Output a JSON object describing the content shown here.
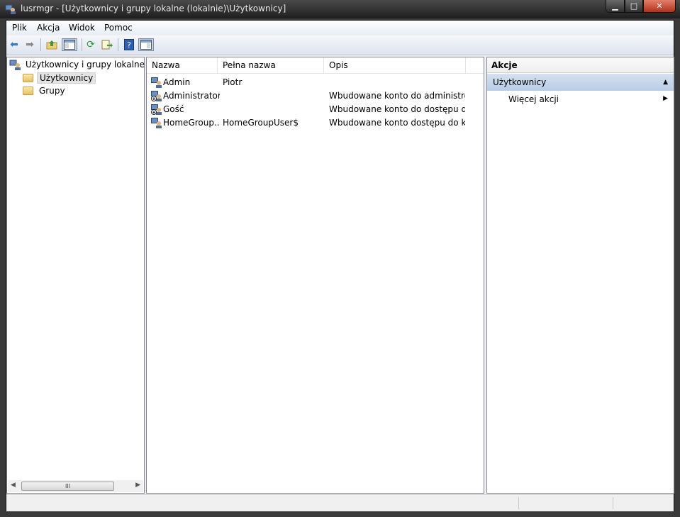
{
  "window": {
    "title": "lusrmgr - [Użytkownicy i grupy lokalne (lokalnie)\\Użytkownicy]"
  },
  "menu": [
    "Plik",
    "Akcja",
    "Widok",
    "Pomoc"
  ],
  "toolbar": {
    "icons": [
      "back-arrow-icon",
      "forward-arrow-icon",
      "up-folder-icon",
      "show-hide-tree-icon",
      "refresh-icon",
      "export-list-icon",
      "help-icon",
      "show-hide-action-pane-icon"
    ]
  },
  "tree": {
    "root": "Użytkownicy i grupy lokalne (lok",
    "items": [
      "Użytkownicy",
      "Grupy"
    ]
  },
  "list": {
    "columns": [
      "Nazwa",
      "Pełna nazwa",
      "Opis"
    ],
    "rows": [
      {
        "name": "Admin",
        "full_name": "Piotr",
        "description": ""
      },
      {
        "name": "Administrator",
        "full_name": "",
        "description": "Wbudowane konto do administro..."
      },
      {
        "name": "Gość",
        "full_name": "",
        "description": "Wbudowane konto do dostępu d..."
      },
      {
        "name": "HomeGroup...",
        "full_name": "HomeGroupUser$",
        "description": "Wbudowane konto dostępu do k..."
      }
    ]
  },
  "actions": {
    "header": "Akcje",
    "section": "Użytkownicy",
    "item": "Więcej akcji"
  },
  "colors": {
    "selection": "#b9cce5",
    "window_frame": "#3a3a3a",
    "close_button": "#c8452e"
  }
}
